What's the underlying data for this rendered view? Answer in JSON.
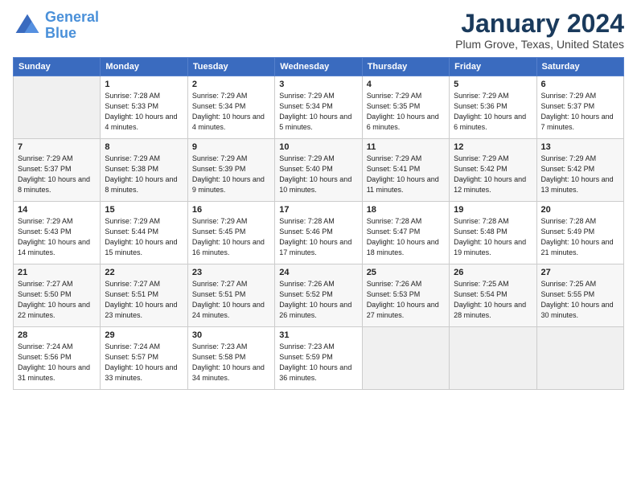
{
  "logo": {
    "line1": "General",
    "line2": "Blue"
  },
  "title": "January 2024",
  "location": "Plum Grove, Texas, United States",
  "weekdays": [
    "Sunday",
    "Monday",
    "Tuesday",
    "Wednesday",
    "Thursday",
    "Friday",
    "Saturday"
  ],
  "weeks": [
    [
      {
        "day": "",
        "sunrise": "",
        "sunset": "",
        "daylight": ""
      },
      {
        "day": "1",
        "sunrise": "Sunrise: 7:28 AM",
        "sunset": "Sunset: 5:33 PM",
        "daylight": "Daylight: 10 hours and 4 minutes."
      },
      {
        "day": "2",
        "sunrise": "Sunrise: 7:29 AM",
        "sunset": "Sunset: 5:34 PM",
        "daylight": "Daylight: 10 hours and 4 minutes."
      },
      {
        "day": "3",
        "sunrise": "Sunrise: 7:29 AM",
        "sunset": "Sunset: 5:34 PM",
        "daylight": "Daylight: 10 hours and 5 minutes."
      },
      {
        "day": "4",
        "sunrise": "Sunrise: 7:29 AM",
        "sunset": "Sunset: 5:35 PM",
        "daylight": "Daylight: 10 hours and 6 minutes."
      },
      {
        "day": "5",
        "sunrise": "Sunrise: 7:29 AM",
        "sunset": "Sunset: 5:36 PM",
        "daylight": "Daylight: 10 hours and 6 minutes."
      },
      {
        "day": "6",
        "sunrise": "Sunrise: 7:29 AM",
        "sunset": "Sunset: 5:37 PM",
        "daylight": "Daylight: 10 hours and 7 minutes."
      }
    ],
    [
      {
        "day": "7",
        "sunrise": "Sunrise: 7:29 AM",
        "sunset": "Sunset: 5:37 PM",
        "daylight": "Daylight: 10 hours and 8 minutes."
      },
      {
        "day": "8",
        "sunrise": "Sunrise: 7:29 AM",
        "sunset": "Sunset: 5:38 PM",
        "daylight": "Daylight: 10 hours and 8 minutes."
      },
      {
        "day": "9",
        "sunrise": "Sunrise: 7:29 AM",
        "sunset": "Sunset: 5:39 PM",
        "daylight": "Daylight: 10 hours and 9 minutes."
      },
      {
        "day": "10",
        "sunrise": "Sunrise: 7:29 AM",
        "sunset": "Sunset: 5:40 PM",
        "daylight": "Daylight: 10 hours and 10 minutes."
      },
      {
        "day": "11",
        "sunrise": "Sunrise: 7:29 AM",
        "sunset": "Sunset: 5:41 PM",
        "daylight": "Daylight: 10 hours and 11 minutes."
      },
      {
        "day": "12",
        "sunrise": "Sunrise: 7:29 AM",
        "sunset": "Sunset: 5:42 PM",
        "daylight": "Daylight: 10 hours and 12 minutes."
      },
      {
        "day": "13",
        "sunrise": "Sunrise: 7:29 AM",
        "sunset": "Sunset: 5:42 PM",
        "daylight": "Daylight: 10 hours and 13 minutes."
      }
    ],
    [
      {
        "day": "14",
        "sunrise": "Sunrise: 7:29 AM",
        "sunset": "Sunset: 5:43 PM",
        "daylight": "Daylight: 10 hours and 14 minutes."
      },
      {
        "day": "15",
        "sunrise": "Sunrise: 7:29 AM",
        "sunset": "Sunset: 5:44 PM",
        "daylight": "Daylight: 10 hours and 15 minutes."
      },
      {
        "day": "16",
        "sunrise": "Sunrise: 7:29 AM",
        "sunset": "Sunset: 5:45 PM",
        "daylight": "Daylight: 10 hours and 16 minutes."
      },
      {
        "day": "17",
        "sunrise": "Sunrise: 7:28 AM",
        "sunset": "Sunset: 5:46 PM",
        "daylight": "Daylight: 10 hours and 17 minutes."
      },
      {
        "day": "18",
        "sunrise": "Sunrise: 7:28 AM",
        "sunset": "Sunset: 5:47 PM",
        "daylight": "Daylight: 10 hours and 18 minutes."
      },
      {
        "day": "19",
        "sunrise": "Sunrise: 7:28 AM",
        "sunset": "Sunset: 5:48 PM",
        "daylight": "Daylight: 10 hours and 19 minutes."
      },
      {
        "day": "20",
        "sunrise": "Sunrise: 7:28 AM",
        "sunset": "Sunset: 5:49 PM",
        "daylight": "Daylight: 10 hours and 21 minutes."
      }
    ],
    [
      {
        "day": "21",
        "sunrise": "Sunrise: 7:27 AM",
        "sunset": "Sunset: 5:50 PM",
        "daylight": "Daylight: 10 hours and 22 minutes."
      },
      {
        "day": "22",
        "sunrise": "Sunrise: 7:27 AM",
        "sunset": "Sunset: 5:51 PM",
        "daylight": "Daylight: 10 hours and 23 minutes."
      },
      {
        "day": "23",
        "sunrise": "Sunrise: 7:27 AM",
        "sunset": "Sunset: 5:51 PM",
        "daylight": "Daylight: 10 hours and 24 minutes."
      },
      {
        "day": "24",
        "sunrise": "Sunrise: 7:26 AM",
        "sunset": "Sunset: 5:52 PM",
        "daylight": "Daylight: 10 hours and 26 minutes."
      },
      {
        "day": "25",
        "sunrise": "Sunrise: 7:26 AM",
        "sunset": "Sunset: 5:53 PM",
        "daylight": "Daylight: 10 hours and 27 minutes."
      },
      {
        "day": "26",
        "sunrise": "Sunrise: 7:25 AM",
        "sunset": "Sunset: 5:54 PM",
        "daylight": "Daylight: 10 hours and 28 minutes."
      },
      {
        "day": "27",
        "sunrise": "Sunrise: 7:25 AM",
        "sunset": "Sunset: 5:55 PM",
        "daylight": "Daylight: 10 hours and 30 minutes."
      }
    ],
    [
      {
        "day": "28",
        "sunrise": "Sunrise: 7:24 AM",
        "sunset": "Sunset: 5:56 PM",
        "daylight": "Daylight: 10 hours and 31 minutes."
      },
      {
        "day": "29",
        "sunrise": "Sunrise: 7:24 AM",
        "sunset": "Sunset: 5:57 PM",
        "daylight": "Daylight: 10 hours and 33 minutes."
      },
      {
        "day": "30",
        "sunrise": "Sunrise: 7:23 AM",
        "sunset": "Sunset: 5:58 PM",
        "daylight": "Daylight: 10 hours and 34 minutes."
      },
      {
        "day": "31",
        "sunrise": "Sunrise: 7:23 AM",
        "sunset": "Sunset: 5:59 PM",
        "daylight": "Daylight: 10 hours and 36 minutes."
      },
      {
        "day": "",
        "sunrise": "",
        "sunset": "",
        "daylight": ""
      },
      {
        "day": "",
        "sunrise": "",
        "sunset": "",
        "daylight": ""
      },
      {
        "day": "",
        "sunrise": "",
        "sunset": "",
        "daylight": ""
      }
    ]
  ]
}
